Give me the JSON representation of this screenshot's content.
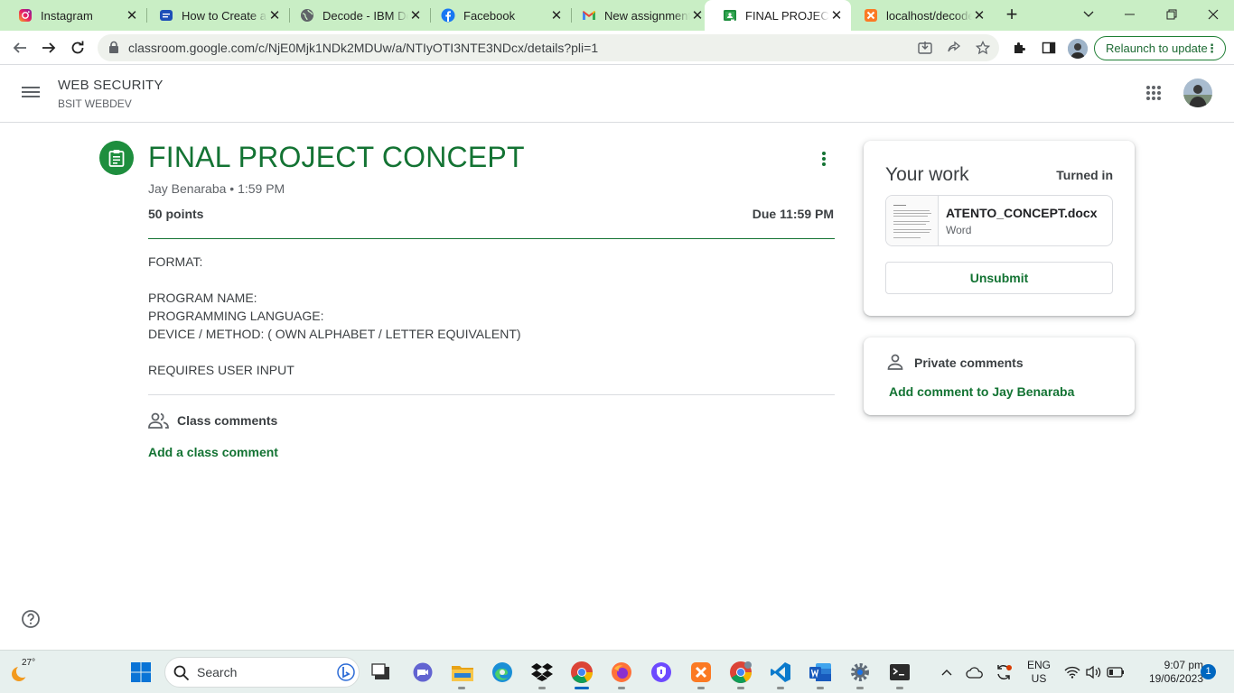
{
  "browser": {
    "tabs": [
      {
        "title": "Instagram",
        "icon": "instagram-icon"
      },
      {
        "title": "How to Create an",
        "icon": "ibm-docs-icon"
      },
      {
        "title": "Decode - IBM Do",
        "icon": "globe-icon"
      },
      {
        "title": "Facebook",
        "icon": "facebook-icon"
      },
      {
        "title": "New assignment:",
        "icon": "gmail-icon"
      },
      {
        "title": "FINAL PROJECT C",
        "icon": "classroom-icon"
      },
      {
        "title": "localhost/decode",
        "icon": "xampp-icon"
      }
    ],
    "url": "classroom.google.com/c/NjE0Mjk1NDk2MDUw/a/NTIyOTI3NTE3NDcx/details?pli=1",
    "relaunch_label": "Relaunch to update"
  },
  "classroom": {
    "course_title": "WEB SECURITY",
    "course_section": "BSIT WEBDEV",
    "assignment": {
      "title": "FINAL PROJECT CONCEPT",
      "meta": "Jay Benaraba • 1:59 PM",
      "points": "50 points",
      "due": "Due 11:59 PM",
      "body": "FORMAT:\n\nPROGRAM NAME:\nPROGRAMMING LANGUAGE:\nDEVICE / METHOD: ( OWN ALPHABET / LETTER EQUIVALENT)\n\nREQUIRES USER INPUT"
    },
    "class_comments": {
      "label": "Class comments",
      "add": "Add a class comment"
    },
    "your_work": {
      "title": "Your work",
      "status": "Turned in",
      "attachment": {
        "name": "ATENTO_CONCEPT.docx",
        "type": "Word"
      },
      "unsubmit_label": "Unsubmit"
    },
    "private_comments": {
      "label": "Private comments",
      "add": "Add comment to Jay Benaraba"
    }
  },
  "taskbar": {
    "weather_temp": "27°",
    "search_label": "Search",
    "language": "ENG",
    "region": "US",
    "time": "9:07 pm",
    "date": "19/06/2023",
    "notifications": "1"
  },
  "colors": {
    "accent_green": "#137333",
    "tab_strip": "#c9eec5"
  }
}
